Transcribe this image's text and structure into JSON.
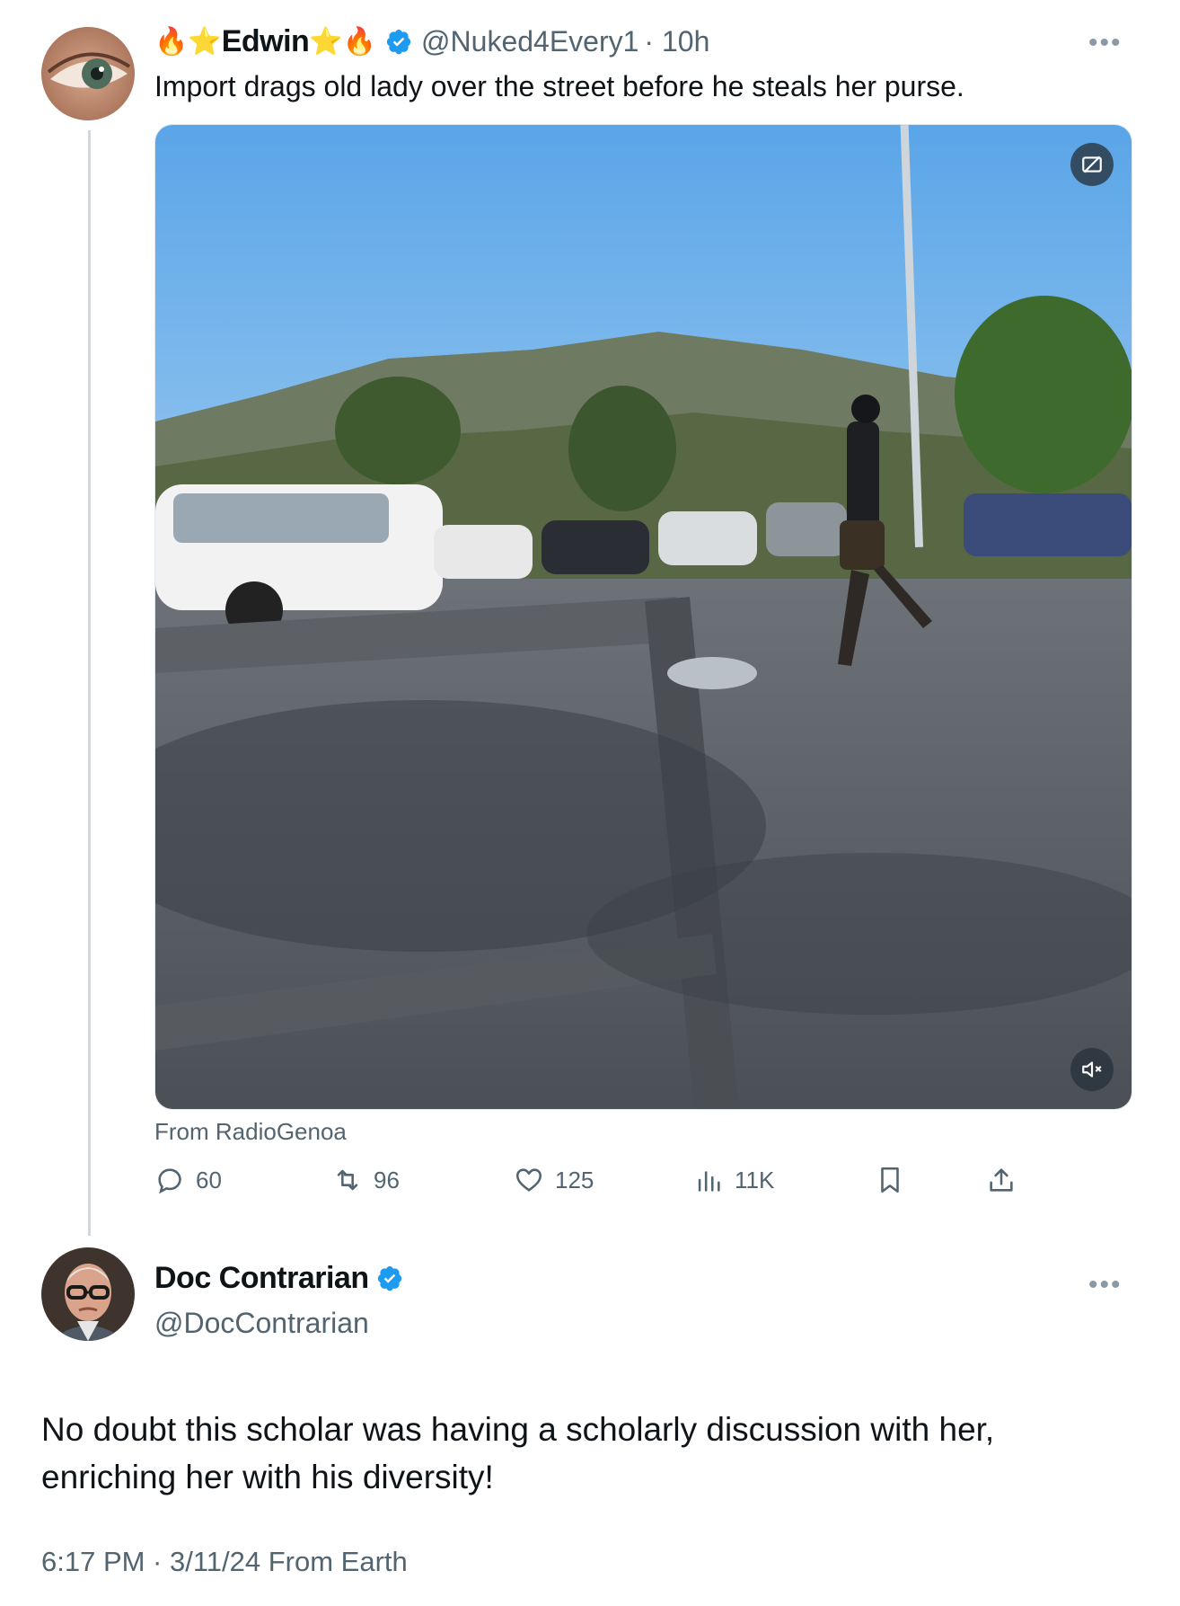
{
  "tweet1": {
    "display_name": "Edwin",
    "name_emoji_left": "🔥⭐",
    "name_emoji_right": "⭐🔥",
    "handle": "@Nuked4Every1",
    "time": "· 10h",
    "text": "Import drags old lady over the street before he steals her purse.",
    "media_source": "From RadioGenoa",
    "replies": "60",
    "retweets": "96",
    "likes": "125",
    "views": "11K"
  },
  "tweet2": {
    "display_name": "Doc Contrarian",
    "handle": "@DocContrarian",
    "text": "No doubt this scholar was having a scholarly discussion with her, enriching her with his diversity!",
    "timestamp": "6:17 PM · 3/11/24 From Earth"
  },
  "icons": {
    "verified": "verified-badge-icon",
    "more": "more-options-icon",
    "reply": "reply-icon",
    "retweet": "retweet-icon",
    "like": "heart-icon",
    "views": "views-icon",
    "bookmark": "bookmark-icon",
    "share": "share-icon",
    "sensitive": "sensitive-content-icon",
    "mute": "mute-icon"
  },
  "colors": {
    "verified_blue": "#1d9bf0",
    "muted_text": "#536471",
    "thread_line": "#cfd9de"
  }
}
